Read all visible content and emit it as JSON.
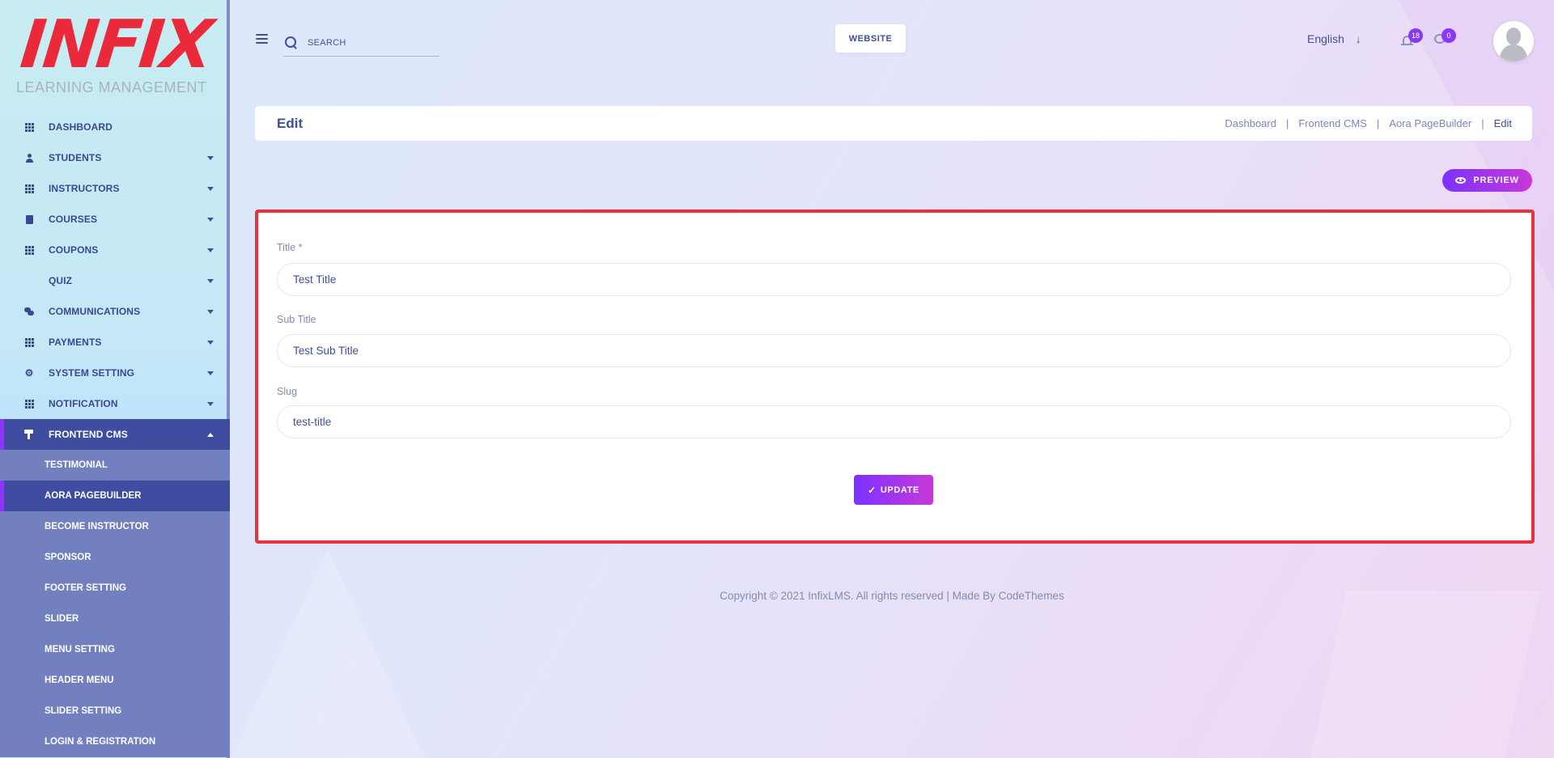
{
  "brand": {
    "logo_text": "INFIX",
    "logo_subtitle": "LEARNING MANAGEMENT",
    "logo_color": "#ea2a3a"
  },
  "sidebar": {
    "items": [
      {
        "label": "DASHBOARD",
        "icon": "grid-icon",
        "has_caret": false
      },
      {
        "label": "STUDENTS",
        "icon": "user-icon",
        "has_caret": true
      },
      {
        "label": "INSTRUCTORS",
        "icon": "grid-icon",
        "has_caret": true
      },
      {
        "label": "COURSES",
        "icon": "book-icon",
        "has_caret": true
      },
      {
        "label": "COUPONS",
        "icon": "grid-icon",
        "has_caret": true
      },
      {
        "label": "QUIZ",
        "icon": "question-icon",
        "has_caret": true
      },
      {
        "label": "COMMUNICATIONS",
        "icon": "chat-icon",
        "has_caret": true
      },
      {
        "label": "PAYMENTS",
        "icon": "grid-icon",
        "has_caret": true
      },
      {
        "label": "SYSTEM SETTING",
        "icon": "cogs-icon",
        "has_caret": true
      },
      {
        "label": "NOTIFICATION",
        "icon": "grid-icon",
        "has_caret": true
      },
      {
        "label": "FRONTEND CMS",
        "icon": "paint-roller-icon",
        "has_caret": true,
        "active": true
      }
    ],
    "submenu": [
      {
        "label": "TESTIMONIAL"
      },
      {
        "label": "AORA PAGEBUILDER",
        "current": true
      },
      {
        "label": "BECOME INSTRUCTOR"
      },
      {
        "label": "SPONSOR"
      },
      {
        "label": "FOOTER SETTING"
      },
      {
        "label": "SLIDER"
      },
      {
        "label": "MENU SETTING"
      },
      {
        "label": "HEADER MENU"
      },
      {
        "label": "SLIDER SETTING"
      },
      {
        "label": "LOGIN & REGISTRATION"
      }
    ]
  },
  "header": {
    "search_placeholder": "SEARCH",
    "website_label": "WEBSITE",
    "language": "English",
    "notification_count": "18",
    "message_count": "0"
  },
  "page": {
    "title": "Edit",
    "breadcrumb": [
      "Dashboard",
      "Frontend CMS",
      "Aora PageBuilder",
      "Edit"
    ],
    "preview_label": "PREVIEW"
  },
  "form": {
    "title_label": "Title *",
    "title_value": "Test Title",
    "subtitle_label": "Sub Title",
    "subtitle_value": "Test Sub Title",
    "slug_label": "Slug",
    "slug_value": "test-title",
    "update_label": "UPDATE"
  },
  "footer": {
    "text": "Copyright © 2021 InfixLMS. All rights reserved | Made By CodeThemes"
  },
  "colors": {
    "accent": "#7c32ff",
    "accent_end": "#c738d8",
    "primary_text": "#415094",
    "active_menu_bg": "#3e4da0",
    "highlight_border": "#e8333f"
  }
}
